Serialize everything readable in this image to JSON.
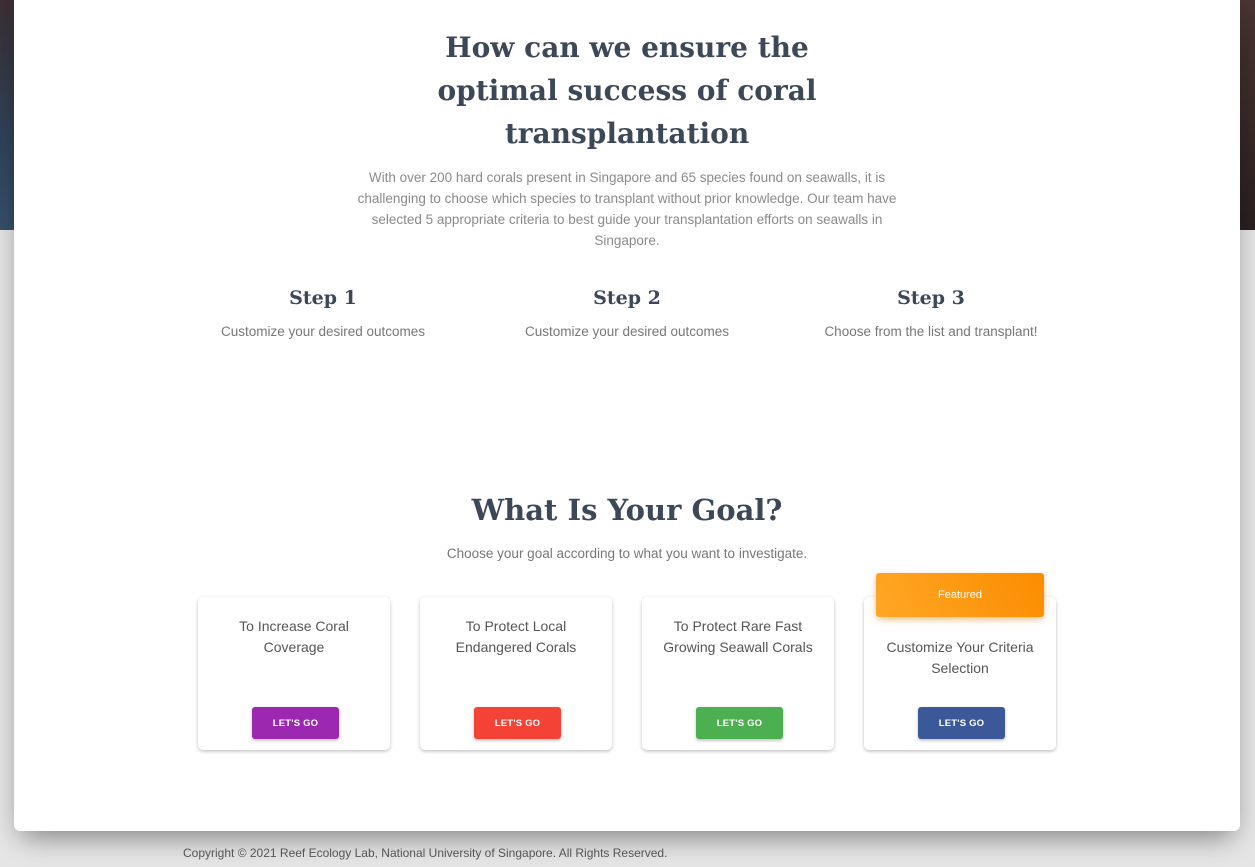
{
  "hero": {
    "headline_lines": [
      "How can we ensure the",
      "optimal success of coral",
      "transplantation"
    ],
    "intro": "With over 200 hard corals present in Singapore and 65 species found on seawalls, it is challenging to choose which species to transplant without prior knowledge. Our team have selected 5 appropriate criteria to best guide your transplantation efforts on seawalls in Singapore."
  },
  "steps": [
    {
      "title": "Step 1",
      "text": "Customize your desired outcomes"
    },
    {
      "title": "Step 2",
      "text": "Customize your desired outcomes"
    },
    {
      "title": "Step 3",
      "text": "Choose from the list and transplant!"
    }
  ],
  "goal": {
    "title": "What Is Your Goal?",
    "subtitle": "Choose your goal according to what you want to investigate.",
    "featured_label": "Featured",
    "cards": [
      {
        "label": "To Increase Coral Coverage",
        "button": "LET'S GO",
        "button_color": "#9c27b0"
      },
      {
        "label": "To Protect Local Endangered Corals",
        "button": "LET'S GO",
        "button_color": "#f44336"
      },
      {
        "label": "To Protect Rare Fast Growing Seawall Corals",
        "button": "LET'S GO",
        "button_color": "#4caf50"
      },
      {
        "label": "Customize Your Criteria Selection",
        "button": "LET'S GO",
        "button_color": "#3b5998"
      }
    ]
  },
  "footer": {
    "copyright": "Copyright © 2021 Reef Ecology Lab, National University of Singapore. All Rights Reserved."
  }
}
